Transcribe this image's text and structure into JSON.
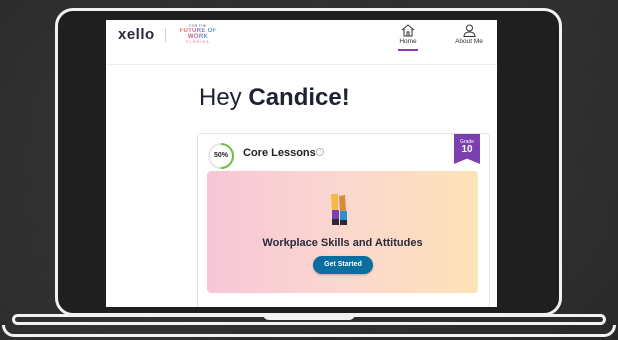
{
  "brand": {
    "logo": "xello",
    "partner_top": "FOR THE",
    "partner_main": "FUTURE OF WORK",
    "partner_state": "FLORIDA"
  },
  "nav": {
    "home": "Home",
    "about": "About Me"
  },
  "greeting": {
    "prefix": "Hey ",
    "name": "Candice!"
  },
  "core_lessons": {
    "progress_text": "50%",
    "progress_value": 0.5,
    "title": "Core Lessons",
    "grade_label": "Grade",
    "grade_value": "10",
    "lesson_title": "Workplace Skills and Attitudes",
    "cta": "Get Started"
  },
  "colors": {
    "progress": "#6cc04a",
    "grade_badge": "#7b3fb0",
    "cta": "#0a6f9e",
    "nav_active": "#8a3ab9"
  }
}
